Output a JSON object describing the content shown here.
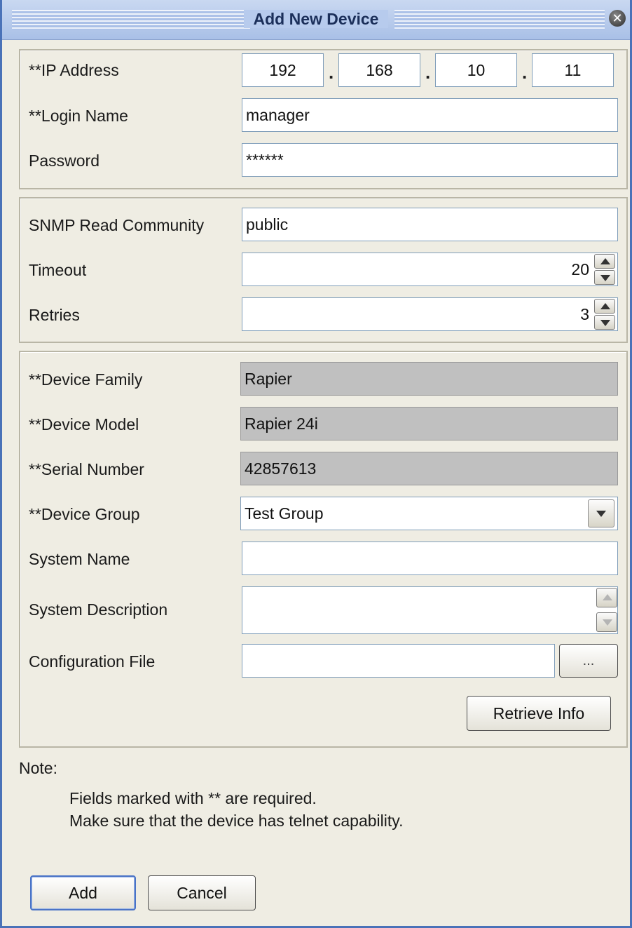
{
  "window": {
    "title": "Add New Device"
  },
  "credentials": {
    "ip_label": "**IP Address",
    "ip_octets": [
      "192",
      "168",
      "10",
      "11"
    ],
    "ip_separator": ".",
    "login_label": "**Login Name",
    "login_value": "manager",
    "password_label": "Password",
    "password_value": "******"
  },
  "snmp": {
    "community_label": "SNMP Read Community",
    "community_value": "public",
    "timeout_label": "Timeout",
    "timeout_value": "20",
    "retries_label": "Retries",
    "retries_value": "3"
  },
  "device": {
    "family_label": "**Device Family",
    "family_value": "Rapier",
    "model_label": "**Device Model",
    "model_value": "Rapier 24i",
    "serial_label": "**Serial Number",
    "serial_value": "42857613",
    "group_label": "**Device Group",
    "group_value": "Test Group",
    "sysname_label": "System Name",
    "sysname_value": "",
    "sysdesc_label": "System Description",
    "sysdesc_value": "",
    "config_label": "Configuration File",
    "config_value": "",
    "browse_label": "...",
    "retrieve_label": "Retrieve Info"
  },
  "note": {
    "label": "Note:",
    "lines": [
      "Fields marked with ** are required.",
      "Make sure that the device has telnet capability."
    ]
  },
  "buttons": {
    "add_label": "Add",
    "cancel_label": "Cancel"
  },
  "colors": {
    "titlebar": "#b7cbed",
    "window_bg": "#efede3",
    "readonly_field": "#c0c0c0",
    "default_button_border": "#4a73c6"
  }
}
